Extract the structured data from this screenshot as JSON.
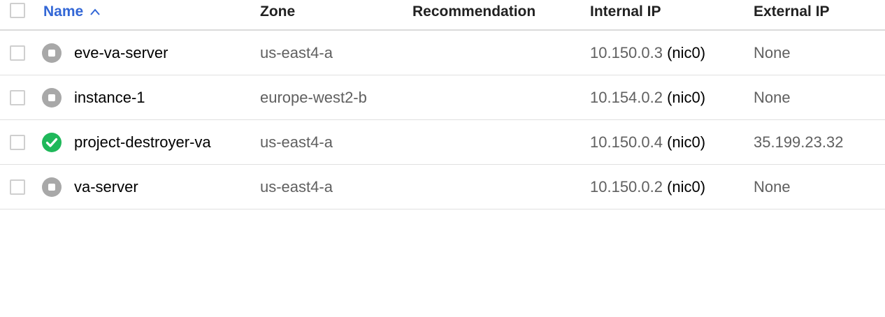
{
  "header": {
    "name": "Name",
    "zone": "Zone",
    "recommendation": "Recommendation",
    "internal_ip": "Internal IP",
    "external_ip": "External IP"
  },
  "rows": [
    {
      "status": "stopped",
      "status_icon": "stopped-icon",
      "name": "eve-va-server",
      "zone": "us-east4-a",
      "recommendation": "",
      "internal_ip": "10.150.0.3",
      "nic": "(nic0)",
      "external_ip": "None"
    },
    {
      "status": "stopped",
      "status_icon": "stopped-icon",
      "name": "instance-1",
      "zone": "europe-west2-b",
      "recommendation": "",
      "internal_ip": "10.154.0.2",
      "nic": "(nic0)",
      "external_ip": "None"
    },
    {
      "status": "running",
      "status_icon": "check-circle-icon",
      "name": "project-destroyer-va",
      "zone": "us-east4-a",
      "recommendation": "",
      "internal_ip": "10.150.0.4",
      "nic": "(nic0)",
      "external_ip": "35.199.23.32"
    },
    {
      "status": "stopped",
      "status_icon": "stopped-icon",
      "name": "va-server",
      "zone": "us-east4-a",
      "recommendation": "",
      "internal_ip": "10.150.0.2",
      "nic": "(nic0)",
      "external_ip": "None"
    }
  ],
  "colors": {
    "accent": "#3367d6",
    "running": "#1fb85a",
    "stopped": "#a8a8a8"
  }
}
